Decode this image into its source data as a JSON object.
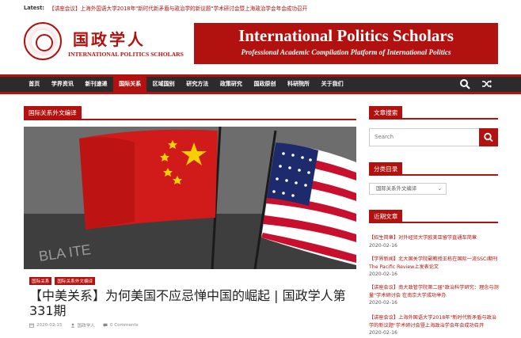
{
  "ticker": {
    "label": "Latest:",
    "headline": "【讲座会议】上海外国语大学2018年\"新时代新矛盾与政治学的新议题\"学术研讨会暨上海政治学会年会成功召开"
  },
  "logo": {
    "cn": "国政学人",
    "en": "INTERNATIONAL POLITICS SCHOLARS"
  },
  "banner": {
    "title": "International Politics Scholars",
    "subtitle": "Professional Academic Compilation Platform of International Politics"
  },
  "nav": {
    "items": [
      "首页",
      "学界资讯",
      "新刊速递",
      "国际关系",
      "区域国别",
      "研究方法",
      "政策研究",
      "国政原创",
      "科研院所",
      "关于我们"
    ],
    "active_index": 3,
    "icons": [
      "search-icon",
      "shuffle-icon"
    ]
  },
  "colors": {
    "accent": "#b1120f",
    "nav_bg": "#2b2b2b"
  },
  "category": {
    "title": "国际关系外文编译"
  },
  "post": {
    "tags": [
      "国际关系",
      "国际关系外文编译"
    ],
    "title": "【中美关系】为何美国不应忌惮中国的崛起 | 国政学人第331期",
    "date": "2020-02-15",
    "author": "国政学人",
    "comments": "0 Comments"
  },
  "sidebar": {
    "search": {
      "heading": "文章搜索",
      "placeholder": "Search"
    },
    "categories": {
      "heading": "分类目录",
      "selected": "国际关系外文编译"
    },
    "recent": {
      "heading": "近期文章",
      "items": [
        {
          "head": "【招生简章】",
          "text": "对外经贸大学欧美亚留学直通车简章",
          "date": "2020-02-16"
        },
        {
          "head": "【学界新闻】",
          "text": "北大国关学院副教授王栋在国际一流SSCI期刊The Pacific Review上发表论文",
          "date": "2020-02-16"
        },
        {
          "head": "【讲座会议】",
          "text": "南大政管学院第二届\"政治科学研究：理念与测量\"学术研讨会 在南京大学成功举办",
          "date": "2020-02-16"
        },
        {
          "head": "【讲座会议】",
          "text": "上海外国语大学2018年\"新时代新矛盾与政治学的新议题\"学术研讨会暨上海政治学会年会成功召开",
          "date": "2020-02-16"
        }
      ]
    }
  }
}
